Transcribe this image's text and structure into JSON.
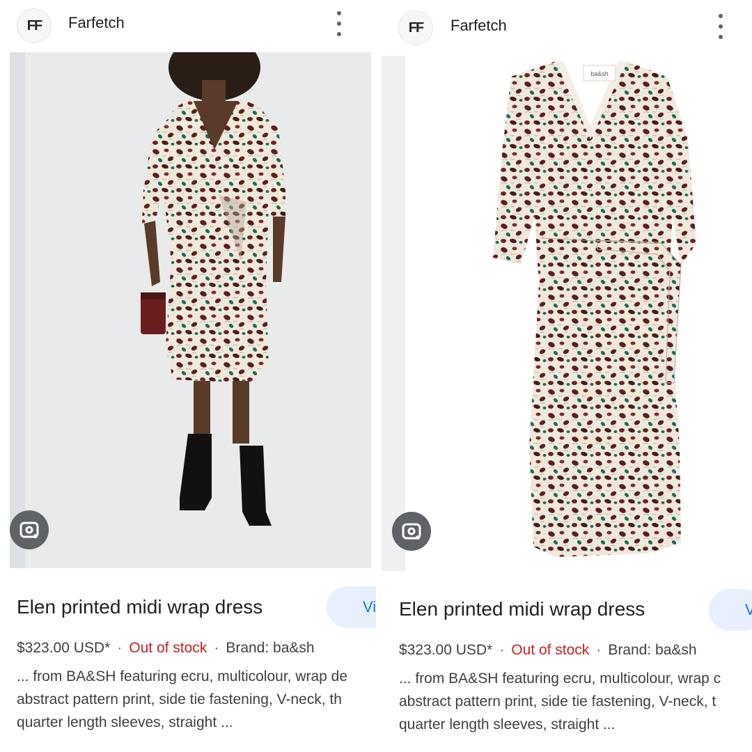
{
  "left": {
    "site_name": "Farfetch",
    "logo_text": "FF",
    "title": "Elen printed midi wrap dress",
    "visit_label": "Vi",
    "price": "$323.00 USD*",
    "stock": "Out of stock",
    "brand": "Brand: ba&sh",
    "desc_lines": [
      "... from BA&SH featuring ecru, multicolour, wrap de",
      "abstract pattern print, side tie fastening, V-neck, th",
      "quarter length sleeves, straight ..."
    ]
  },
  "right": {
    "site_name": "Farfetch",
    "logo_text": "FF",
    "title": "Elen printed midi wrap dress",
    "visit_label": "V",
    "price": "$323.00 USD*",
    "stock": "Out of stock",
    "brand": "Brand: ba&sh",
    "label_text": "ba&sh",
    "desc_lines": [
      "... from BA&SH featuring ecru, multicolour, wrap c",
      "abstract pattern print, side tie fastening, V-neck, t",
      "quarter length sleeves, straight ..."
    ]
  },
  "separator": "·",
  "icons": [
    "lens-icon",
    "more-vert-icon"
  ],
  "colors": {
    "out_of_stock": "#c5221f",
    "visit_button_bg": "#e8f0fe",
    "visit_button_text": "#1a73e8",
    "dress_burgundy": "#5b1f22",
    "dress_green": "#1f6b5b",
    "dress_ecru": "#efe9dc"
  }
}
